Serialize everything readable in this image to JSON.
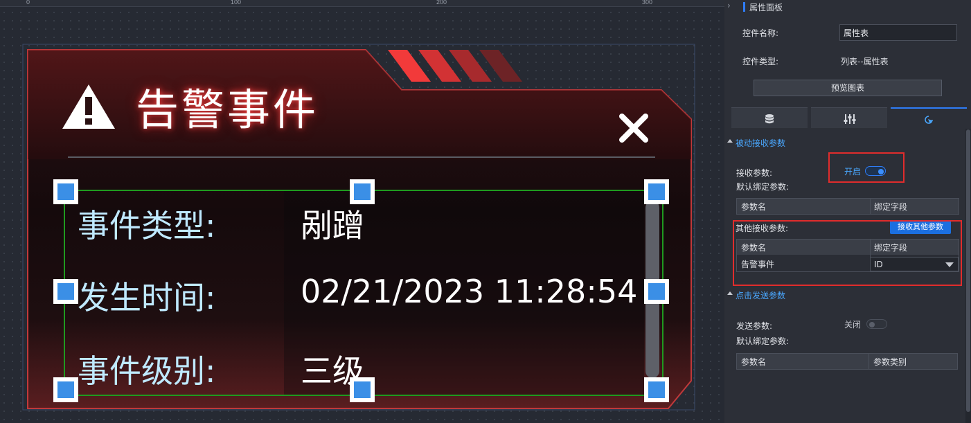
{
  "ruler": {
    "ticks": [
      "0",
      "100",
      "200",
      "300"
    ]
  },
  "popup": {
    "title": "告警事件",
    "rows": [
      {
        "label": "事件类型:",
        "value": "剐蹭"
      },
      {
        "label": "发生时间:",
        "value": "02/21/2023 11:28:54"
      },
      {
        "label": "事件级别:",
        "value": "三级"
      }
    ]
  },
  "panel": {
    "title": "属性面板",
    "control_name_label": "控件名称:",
    "control_name_value": "属性表",
    "control_type_label": "控件类型:",
    "control_type_value": "列表--属性表",
    "preview_button": "预览图表",
    "tabs": [
      {
        "name": "data",
        "icon": "database-icon"
      },
      {
        "name": "style",
        "icon": "sliders-icon"
      },
      {
        "name": "interaction",
        "icon": "pointer-click-icon"
      }
    ],
    "passive_section": {
      "title": "被动接收参数",
      "receive_label": "接收参数:",
      "receive_state": "开启",
      "default_bind_label": "默认绑定参数:",
      "default_table_headers": [
        "参数名",
        "绑定字段"
      ],
      "other_label": "其他接收参数:",
      "other_button": "接收其他参数",
      "other_table_headers": [
        "参数名",
        "绑定字段"
      ],
      "other_table_rows": [
        {
          "param": "告警事件",
          "field": "ID"
        }
      ]
    },
    "click_section": {
      "title": "点击发送参数",
      "send_label": "发送参数:",
      "send_state": "关闭",
      "default_bind_label": "默认绑定参数:",
      "table_headers": [
        "参数名",
        "参数类别"
      ]
    }
  },
  "colors": {
    "accent": "#2f7cf6",
    "link": "#4aa8ff",
    "highlight_border": "#e12c2c",
    "selection_border": "#1f9a1f",
    "handle": "#3b8fe6"
  }
}
